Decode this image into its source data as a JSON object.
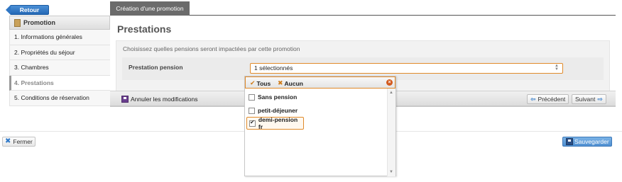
{
  "topbar": {
    "back_label": "Retour",
    "active_tab": "Création d'une promotion"
  },
  "sidebar": {
    "header": "Promotion",
    "items": [
      {
        "label": "1. Informations générales",
        "active": false
      },
      {
        "label": "2. Propriétés du séjour",
        "active": false
      },
      {
        "label": "3. Chambres",
        "active": false
      },
      {
        "label": "4. Prestations",
        "active": true
      },
      {
        "label": "5. Conditions de réservation",
        "active": false
      }
    ]
  },
  "main": {
    "title": "Prestations",
    "description": "Choisissez quelles pensions seront impactées par cette promotion",
    "field_label": "Prestation pension",
    "select_value": "1 sélectionnés",
    "cancel_label": "Annuler les modifications",
    "prev_label": "Précédent",
    "next_label": "Suivant"
  },
  "dropdown": {
    "all_label": "Tous",
    "none_label": "Aucun",
    "options": [
      {
        "label": "Sans pension",
        "checked": false
      },
      {
        "label": "petit-déjeuner",
        "checked": false
      },
      {
        "label": "demi-pension fr",
        "checked": true
      }
    ]
  },
  "footer": {
    "close_label": "Fermer",
    "save_label": "Sauvegarder"
  },
  "colors": {
    "accent_orange": "#e08a2a",
    "primary_blue": "#2d78c8",
    "tab_gray": "#6b6b6b"
  }
}
